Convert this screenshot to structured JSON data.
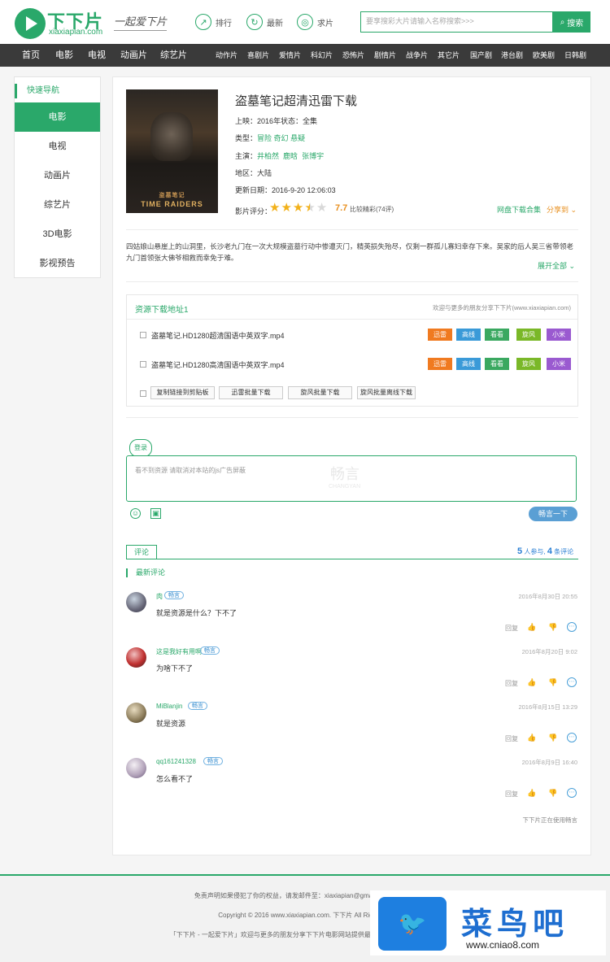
{
  "header": {
    "logo_text": "下下片",
    "logo_domain": "xiaxiapian.com",
    "slogan": "一起爱下片",
    "top_links": [
      {
        "label": "排行",
        "icon": "chart-icon"
      },
      {
        "label": "最新",
        "icon": "refresh-icon"
      },
      {
        "label": "求片",
        "icon": "target-icon"
      }
    ],
    "search_placeholder": "要享搜彩大片请输入名称搜索>>>",
    "search_button": "搜索"
  },
  "nav": {
    "main": [
      "首页",
      "电影",
      "电视",
      "动画片",
      "综艺片"
    ],
    "sub": [
      "动作片",
      "喜剧片",
      "爱情片",
      "科幻片",
      "恐怖片",
      "剧情片",
      "战争片",
      "其它片",
      "国产剧",
      "港台剧",
      "欧美剧",
      "日韩剧"
    ]
  },
  "sidebar": {
    "title": "快速导航",
    "items": [
      "电影",
      "电视",
      "动画片",
      "综艺片",
      "3D电影",
      "影视预告"
    ]
  },
  "movie": {
    "title": "盗墓笔记超清迅雷下载",
    "poster_text": "TIME RAIDERS",
    "poster_cn": "盗墓笔记",
    "year_label": "上映：",
    "year": "2016年",
    "status_label": "状态：",
    "status": "全集",
    "genre_label": "类型：",
    "genres": [
      "冒险",
      "奇幻",
      "悬疑"
    ],
    "cast_label": "主演：",
    "cast": [
      "井柏然",
      "鹿晗",
      "张博宇"
    ],
    "region_label": "地区：",
    "region": "大陆",
    "updated_label": "更新日期：",
    "updated": "2016-9-20 12:06:03",
    "rating_label": "影片评分：",
    "rating": "7.7",
    "rating_note": "比较精彩(74评)",
    "stars": 3.5,
    "cloud_link": "网盘下载合集",
    "share": "分享到",
    "description": "四姑娘山悬崖上的山洞里，长沙老九门在一次大规模盗墓行动中惨遭灭门，精英损失殆尽，仅剩一群孤儿寡妇幸存下来。吴家的后人吴三省带领老九门首领张大佛爷相救而幸免于难。",
    "expand": "展开全部"
  },
  "download": {
    "title": "资源下载地址1",
    "note": "欢迎与更多的朋友分享下下片(www.xiaxiapian.com)",
    "rows": [
      {
        "name": "盗墓笔记.HD1280超清国语中英双字.mp4"
      },
      {
        "name": "盗墓笔记.HD1280高清国语中英双字.mp4"
      }
    ],
    "tags": [
      {
        "label": "迅雷",
        "color": "#f07a20"
      },
      {
        "label": "高线",
        "color": "#3a9ad8"
      },
      {
        "label": "看看",
        "color": "#3aa860"
      },
      {
        "label": "旋风",
        "color": "#7ab828"
      },
      {
        "label": "小米",
        "color": "#9a5ad0"
      }
    ],
    "bulk_buttons": [
      "复制链接到剪贴板",
      "迅雷批量下载",
      "旋风批量下载",
      "旋风批量离线下载"
    ]
  },
  "comments": {
    "login": "登录",
    "placeholder": "看不到资源 请取消对本站的js广告屏蔽",
    "watermark": "畅言",
    "watermark_en": "CHANGYAN",
    "post_button": "畅言一下",
    "tab": "评论",
    "participants": "5",
    "participants_label": "人参与",
    "count": "4",
    "count_label": "条评论",
    "latest_title": "最新评论",
    "reply_label": "回复",
    "list": [
      {
        "user": "肉",
        "badge": "畅言",
        "time": "2016年8月30日 20:55",
        "text": "就是资源是什么？下不了"
      },
      {
        "user": "这是我好有用啊",
        "badge": "畅言",
        "time": "2016年8月20日 9:02",
        "text": "为啥下不了"
      },
      {
        "user": "MiBlanjin",
        "badge": "畅言",
        "time": "2016年8月15日 13:29",
        "text": "就是资源"
      },
      {
        "user": "qq161241328",
        "badge": "畅言",
        "time": "2016年8月9日 16:40",
        "text": "怎么看不了"
      }
    ],
    "powered": "下下片正在使用畅言"
  },
  "footer": {
    "line1": "免责声明如果侵犯了你的权益，请发邮件至：xiaxiapian@gmail.com，我们会",
    "line2": "Copyright © 2016 www.xiaxiapian.com. 下下片 All Rights Re",
    "line3": "「下下片 - 一起爱下片」欢迎与更多的朋友分享下下片电影网站提供最新·迅雷电影下载·免费电"
  },
  "ad": {
    "logo_glyph": "🐦",
    "name": "菜鸟吧",
    "url": "www.cniao8.com"
  },
  "colors": {
    "accent": "#2aa86a",
    "nav_bg": "#3a3a3a",
    "star": "#f2b11a"
  }
}
